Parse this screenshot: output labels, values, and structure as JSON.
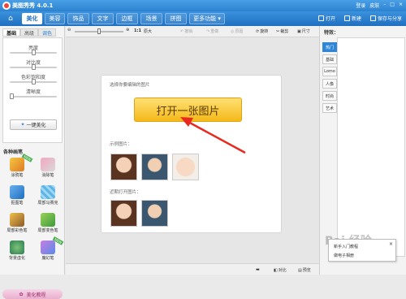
{
  "titlebar": {
    "title": "美图秀秀 4.0.1",
    "login": "登录",
    "skin": "皮肤"
  },
  "menubar": {
    "tabs": [
      "美化",
      "美容",
      "饰品",
      "文字",
      "边框",
      "场景",
      "拼图",
      "更多功能 ▾"
    ],
    "active_tab": "美化",
    "right_buttons": {
      "open": "打开",
      "new": "新建",
      "save": "保存与分享"
    }
  },
  "left_panel": {
    "subtabs": [
      "基础",
      "高级",
      "调色"
    ],
    "sliders": [
      {
        "label": "亮度",
        "value": 0.5
      },
      {
        "label": "对比度",
        "value": 0.5
      },
      {
        "label": "色彩饱和度",
        "value": 0.5
      },
      {
        "label": "清晰度",
        "value": 0.0
      }
    ],
    "one_click": "一键美化",
    "section_title": "各种画笔",
    "tools": [
      "涂鸦笔",
      "消除笔",
      "抠图笔",
      "局部马赛克",
      "局部彩色笔",
      "局部变色笔",
      "背景虚化",
      "魔幻笔"
    ],
    "new_badge": "NEW",
    "bottom_button": "美化教程"
  },
  "toolbar": {
    "zoom_label": "1:1",
    "original_size": "原大",
    "undo": "撤销",
    "redo": "重做",
    "original": "原图",
    "rotate": "旋转",
    "crop": "裁剪",
    "resize": "尺寸"
  },
  "canvas": {
    "prompt": "选择你要编辑的图片",
    "open_button": "打开一张图片",
    "sample_label": "示例图片：",
    "recent_label": "近期打开图片："
  },
  "right_panel": {
    "title": "特效：",
    "tabs": [
      "热门",
      "基础",
      "Lomo",
      "人像",
      "时尚",
      "艺术"
    ],
    "active_tab": "热门"
  },
  "tooltip": {
    "line1": "新手入门教程",
    "line2": "做电子相册"
  },
  "statusbar": {
    "compare": "对比",
    "preview": "预览"
  },
  "watermark": "Bai  经验",
  "colors": {
    "accent": "#2c82cf",
    "open_button": "#f4b91a",
    "arrow": "#e8291f"
  }
}
